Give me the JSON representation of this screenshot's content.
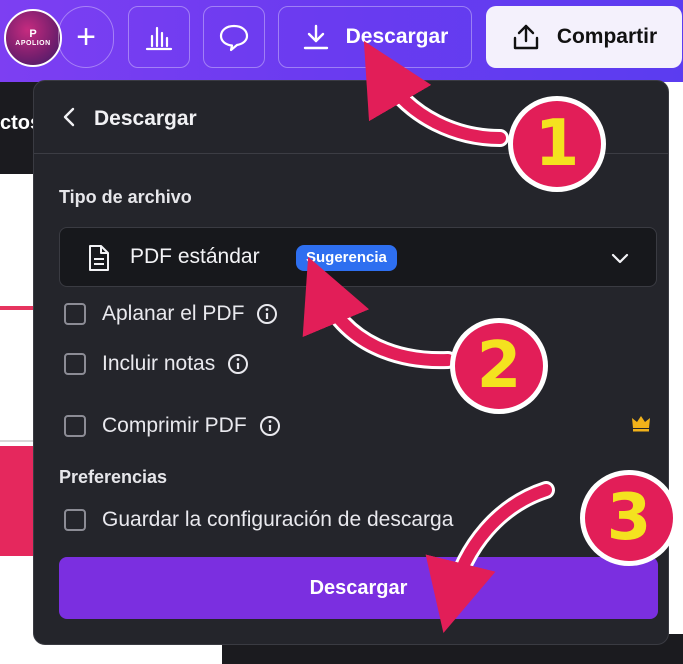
{
  "toolbar": {
    "avatar_mark": "P",
    "avatar_text": "APOLION",
    "plus_glyph": "+",
    "download_label": "Descargar",
    "share_label": "Compartir",
    "icons": [
      "plus-icon",
      "bar-chart-icon",
      "comment-icon",
      "download-icon",
      "upload-icon"
    ]
  },
  "background": {
    "left_tab_text": "ctos"
  },
  "panel": {
    "title": "Descargar",
    "file_type_label": "Tipo de archivo",
    "file_type_value": "PDF estándar",
    "file_type_badge": "Sugerencia",
    "options": [
      {
        "label": "Aplanar el PDF",
        "checked": false
      },
      {
        "label": "Incluir notas",
        "checked": false
      },
      {
        "label": "Comprimir PDF",
        "checked": false
      }
    ],
    "preferences_label": "Preferencias",
    "save_settings_label": "Guardar la configuración de descarga",
    "download_button_label": "Descargar"
  },
  "annotations": {
    "step1": "1",
    "step2": "2",
    "step3": "3"
  },
  "colors": {
    "accent": "#7b2fe0",
    "badge": "#2e6ff0",
    "annotation": "#e21e58",
    "annotation_number": "#f4e21f"
  }
}
